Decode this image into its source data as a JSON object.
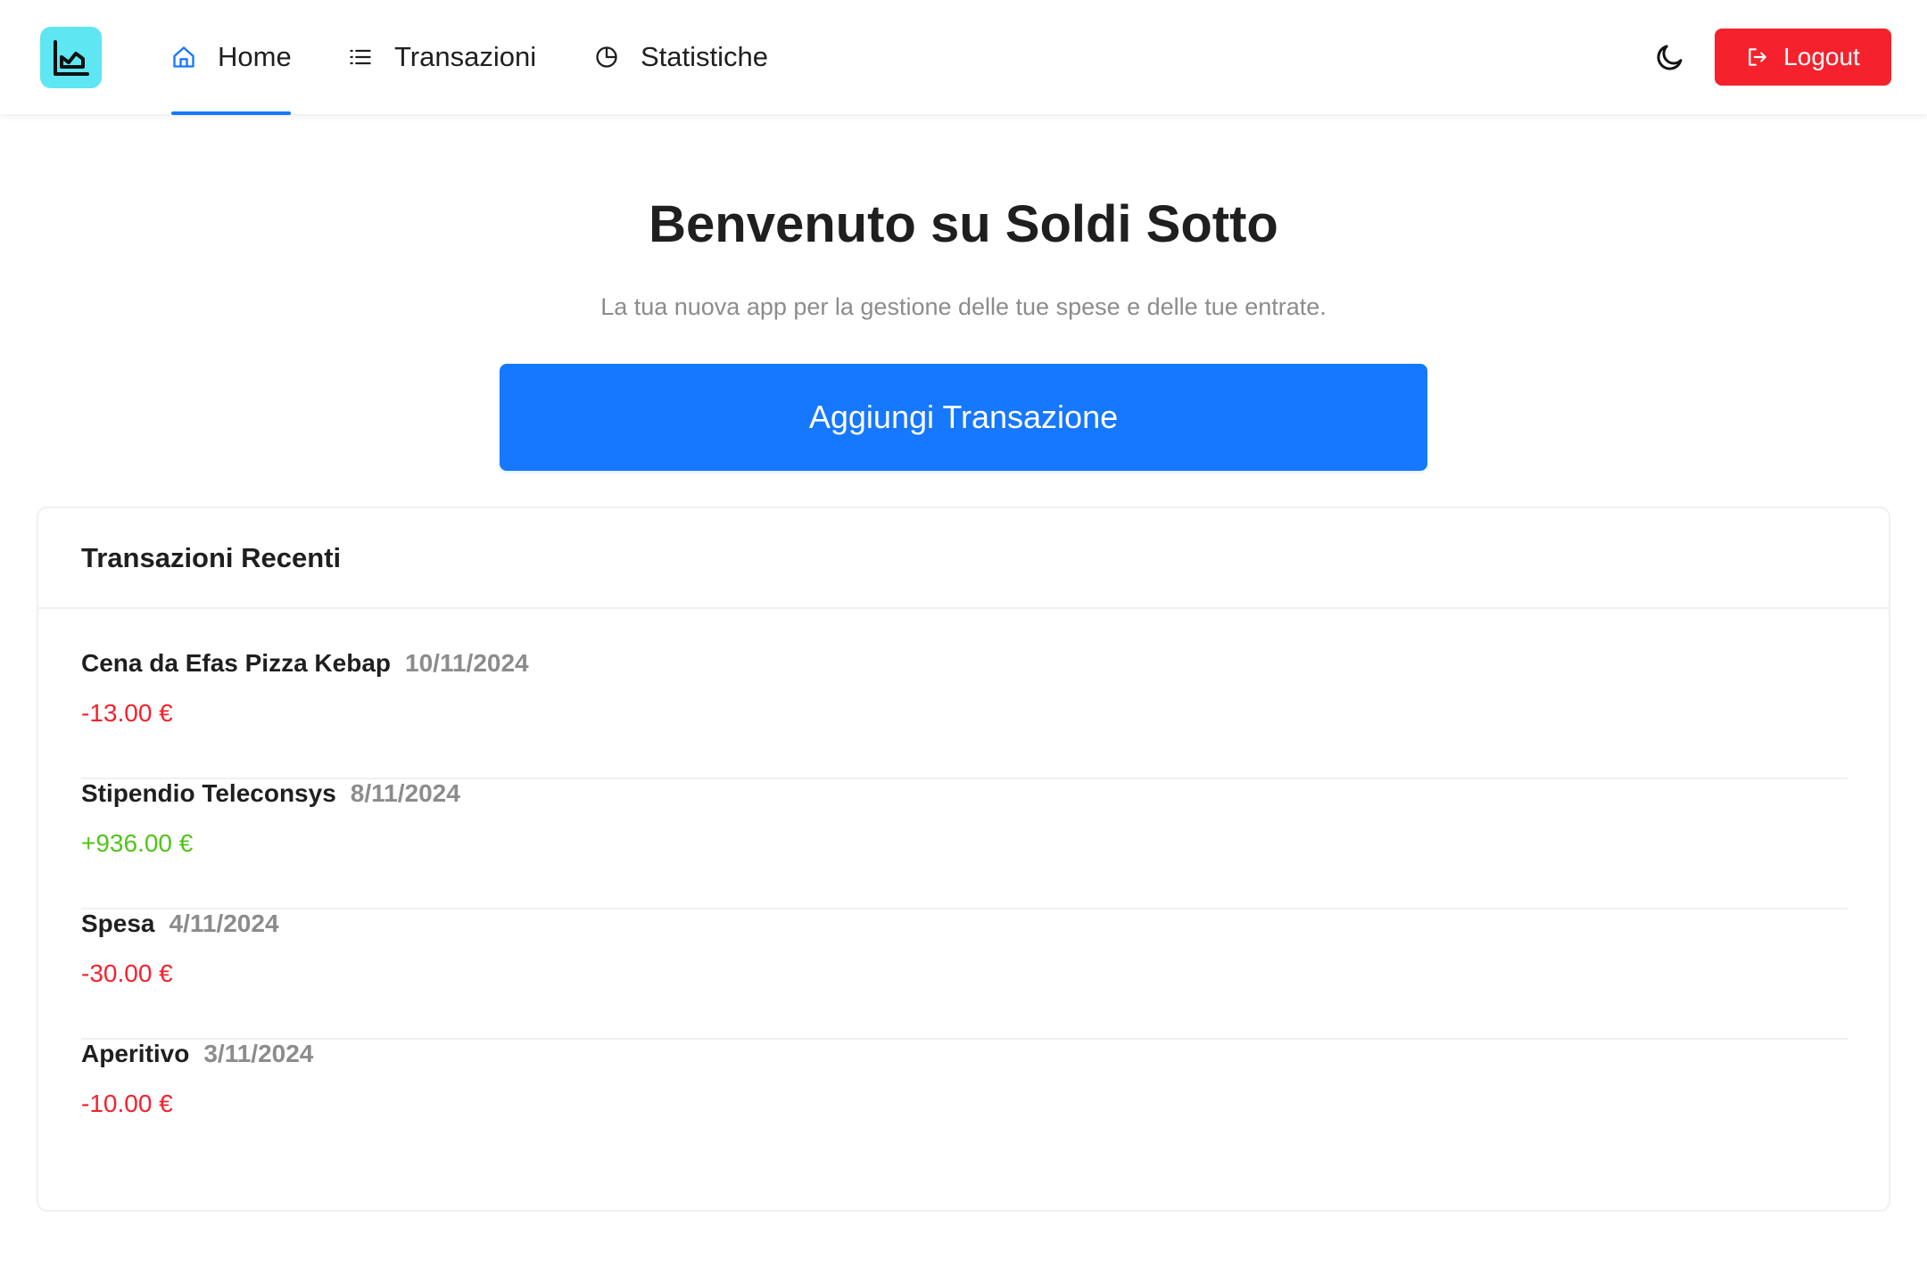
{
  "header": {
    "nav": [
      {
        "label": "Home",
        "icon": "home-icon",
        "active": true
      },
      {
        "label": "Transazioni",
        "icon": "list-icon",
        "active": false
      },
      {
        "label": "Statistiche",
        "icon": "pie-chart-icon",
        "active": false
      }
    ],
    "logout_label": "Logout"
  },
  "hero": {
    "title": "Benvenuto su Soldi Sotto",
    "subtitle": "La tua nuova app per la gestione delle tue spese e delle tue entrate.",
    "add_button_label": "Aggiungi Transazione"
  },
  "recent": {
    "title": "Transazioni Recenti",
    "items": [
      {
        "name": "Cena da Efas Pizza Kebap",
        "date": "10/11/2024",
        "amount": "-13.00 €"
      },
      {
        "name": "Stipendio Teleconsys",
        "date": "8/11/2024",
        "amount": "+936.00 €"
      },
      {
        "name": "Spesa",
        "date": "4/11/2024",
        "amount": "-30.00 €"
      },
      {
        "name": "Aperitivo",
        "date": "3/11/2024",
        "amount": "-10.00 €"
      }
    ]
  },
  "colors": {
    "primary": "#1677ff",
    "danger": "#f5222d",
    "success": "#52c41a",
    "logo_bg": "#5ee6f2"
  }
}
